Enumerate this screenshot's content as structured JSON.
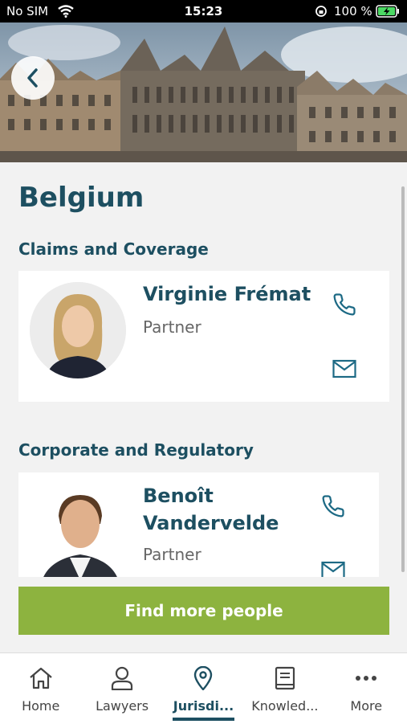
{
  "status_bar": {
    "carrier": "No SIM",
    "time": "15:23",
    "battery": "100 %"
  },
  "page": {
    "title": "Belgium"
  },
  "sections": [
    {
      "heading": "Claims and Coverage",
      "person": {
        "name": "Virginie Frémat",
        "role": "Partner"
      }
    },
    {
      "heading": "Corporate and Regulatory",
      "person": {
        "name": "Benoît Vandervelde",
        "role": "Partner"
      }
    }
  ],
  "find_button": {
    "label": "Find more people"
  },
  "tabs": [
    {
      "label": "Home",
      "icon": "home-icon"
    },
    {
      "label": "Lawyers",
      "icon": "person-icon"
    },
    {
      "label": "Jurisdi...",
      "icon": "location-pin-icon",
      "active": true
    },
    {
      "label": "Knowled...",
      "icon": "book-icon"
    },
    {
      "label": "More",
      "icon": "more-dots-icon"
    }
  ],
  "colors": {
    "primary": "#1d4f61",
    "accent": "#8db33f"
  }
}
